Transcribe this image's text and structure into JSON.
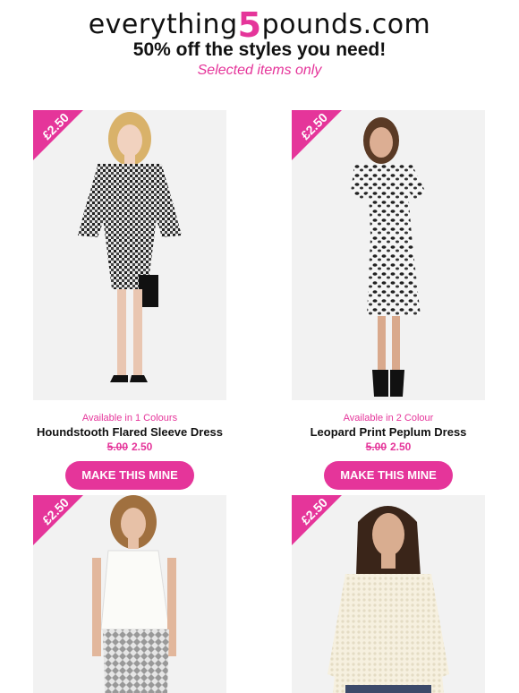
{
  "header": {
    "logo_prefix": "everything",
    "logo_number": "5",
    "logo_suffix": "pounds.com",
    "headline": "50% off the styles you need!",
    "subline": "Selected items only"
  },
  "colors": {
    "accent": "#e5359a"
  },
  "products": [
    {
      "badge": "£2.50",
      "availability": "Available in 1 Colours",
      "name": "Houndstooth Flared Sleeve Dress",
      "old_price": "5.00",
      "new_price": "2.50",
      "cta": "MAKE THIS MINE",
      "image": "woman-in-houndstooth-dress-photo"
    },
    {
      "badge": "£2.50",
      "availability": "Available in 2 Colour",
      "name": "Leopard Print Peplum Dress",
      "old_price": "5.00",
      "new_price": "2.50",
      "cta": "MAKE THIS MINE",
      "image": "woman-in-leopard-print-dress-photo"
    },
    {
      "badge": "£2.50",
      "image": "woman-in-white-top-photo"
    },
    {
      "badge": "£2.50",
      "image": "woman-in-knit-sweater-photo"
    }
  ]
}
